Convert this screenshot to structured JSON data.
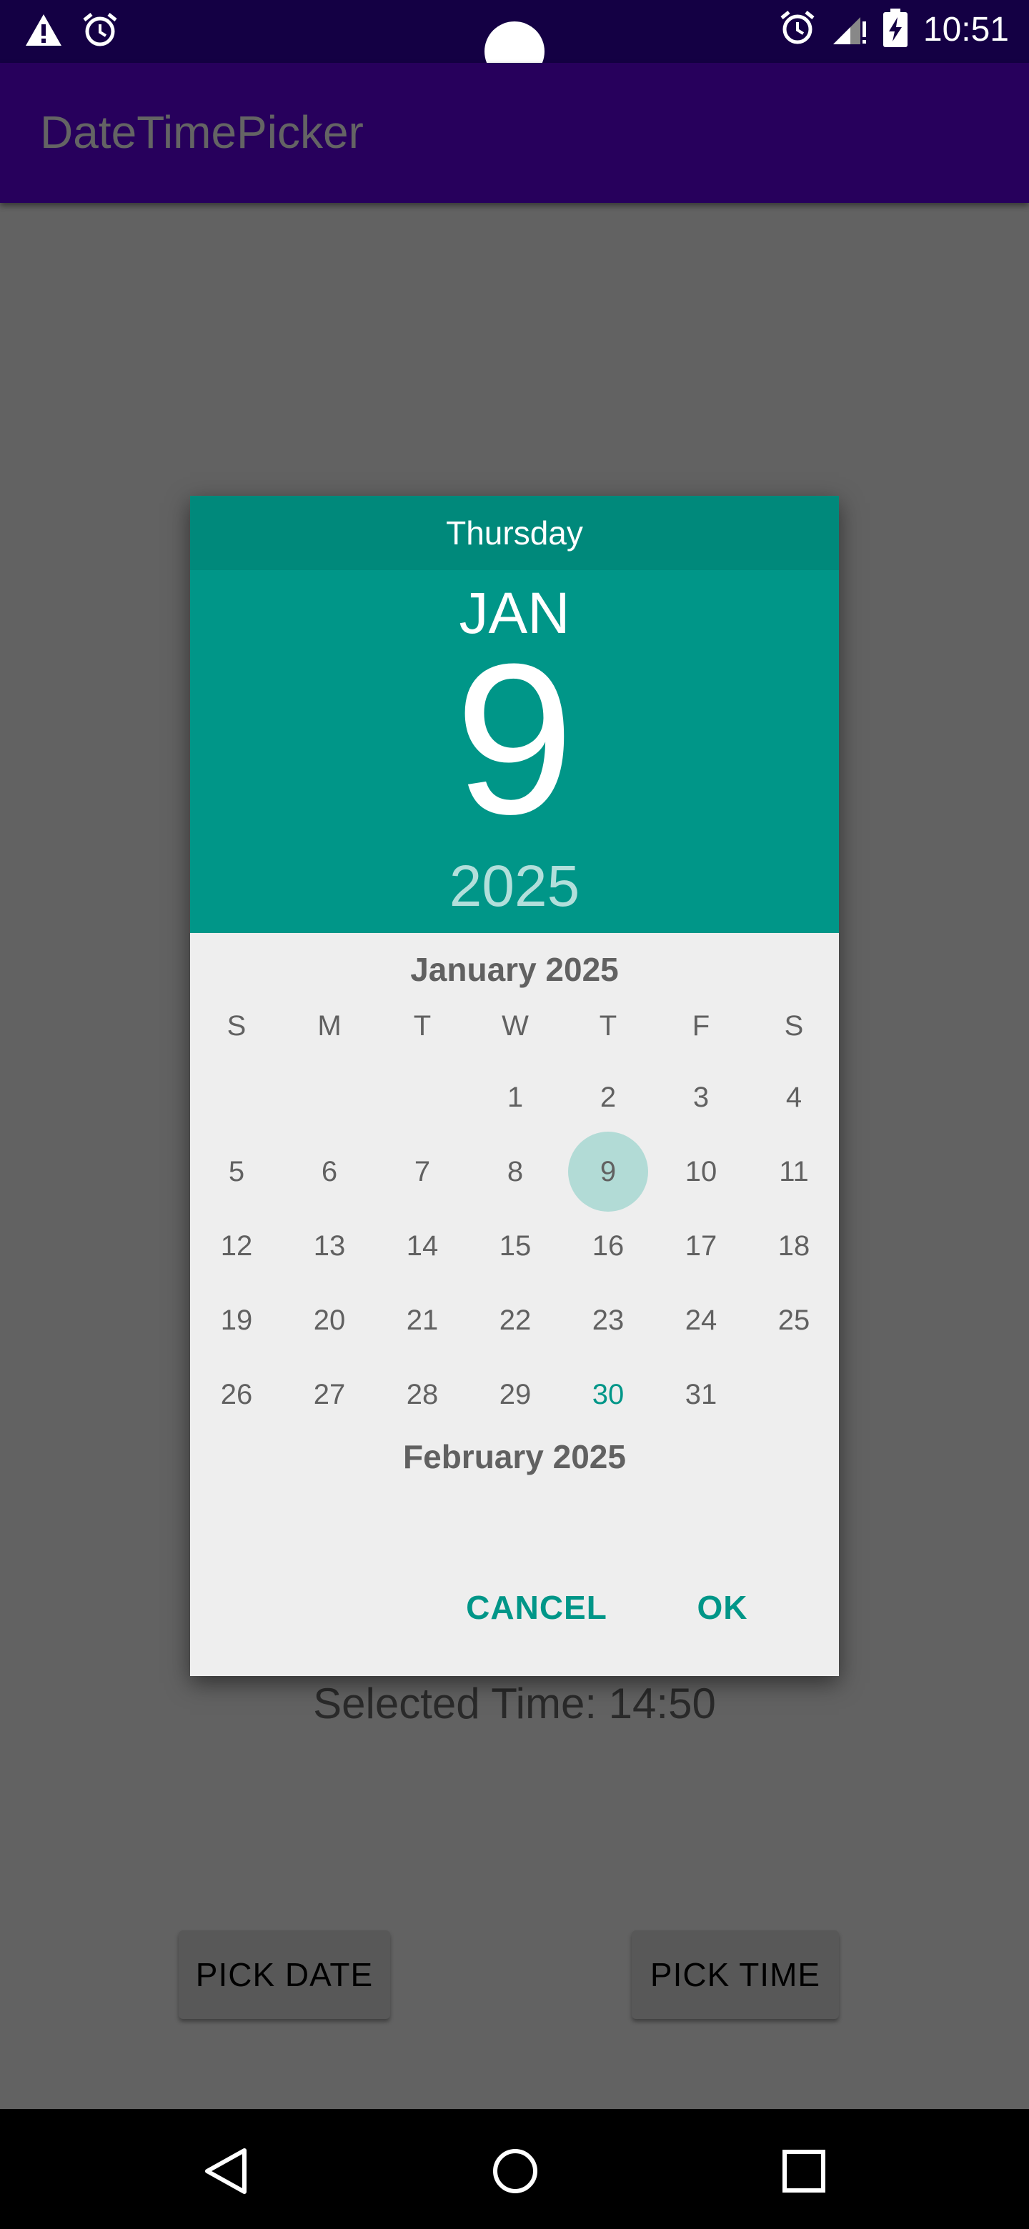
{
  "status_bar": {
    "time": "10:51",
    "left_icons": [
      "warning-icon",
      "alarm-icon"
    ],
    "right_icons": [
      "alarm-icon",
      "signal-icon",
      "battery-charging-icon"
    ]
  },
  "app_bar": {
    "title": "DateTimePicker"
  },
  "background": {
    "selected_time": "Selected Time: 14:50",
    "pick_date_label": "PICK DATE",
    "pick_time_label": "PICK TIME"
  },
  "dialog": {
    "header": {
      "weekday": "Thursday",
      "month": "JAN",
      "day": "9",
      "year": "2025"
    },
    "month_title": "January 2025",
    "next_month_title": "February 2025",
    "weekday_labels": [
      "S",
      "M",
      "T",
      "W",
      "T",
      "F",
      "S"
    ],
    "days": [
      "1",
      "2",
      "3",
      "4",
      "5",
      "6",
      "7",
      "8",
      "9",
      "10",
      "11",
      "12",
      "13",
      "14",
      "15",
      "16",
      "17",
      "18",
      "19",
      "20",
      "21",
      "22",
      "23",
      "24",
      "25",
      "26",
      "27",
      "28",
      "29",
      "30",
      "31"
    ],
    "first_weekday_index": 3,
    "selected_day": "9",
    "today_day": "30",
    "cancel_label": "CANCEL",
    "ok_label": "OK"
  },
  "colors": {
    "accent": "#009688",
    "header_dark": "#00897b",
    "status_bar": "#140044",
    "app_bar": "#27005c"
  },
  "nav_bar": {
    "icons": [
      "back-icon",
      "home-icon",
      "recents-icon"
    ]
  }
}
